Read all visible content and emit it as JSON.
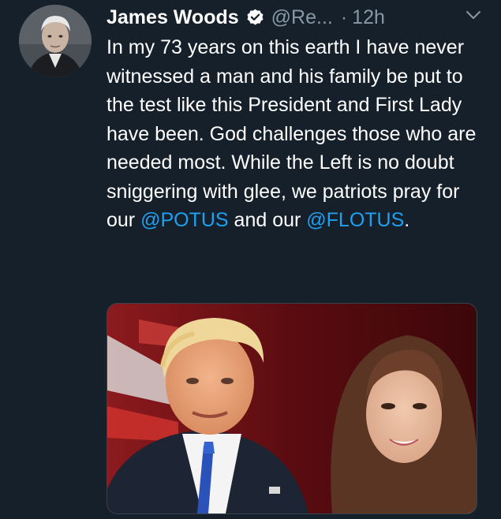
{
  "tweet": {
    "author_name": "James Woods",
    "author_handle": "@Re...",
    "separator": "·",
    "timestamp": "12h",
    "verified": true,
    "text_segments": {
      "t1": "In my 73 years on this earth I have never witnessed a man and his family be put to the test like this President and First Lady have been. God challenges those who are needed most. While the Left is no doubt sniggering with glee, we patriots pray for our ",
      "m1": "@POTUS",
      "t2": " and our ",
      "m2": "@FLOTUS",
      "t3": "."
    }
  },
  "icons": {
    "verified": "verified-badge-icon",
    "menu": "chevron-down-icon"
  },
  "colors": {
    "background": "#15202b",
    "text": "#ffffff",
    "secondary_text": "#8899a6",
    "link": "#1da1f2"
  }
}
